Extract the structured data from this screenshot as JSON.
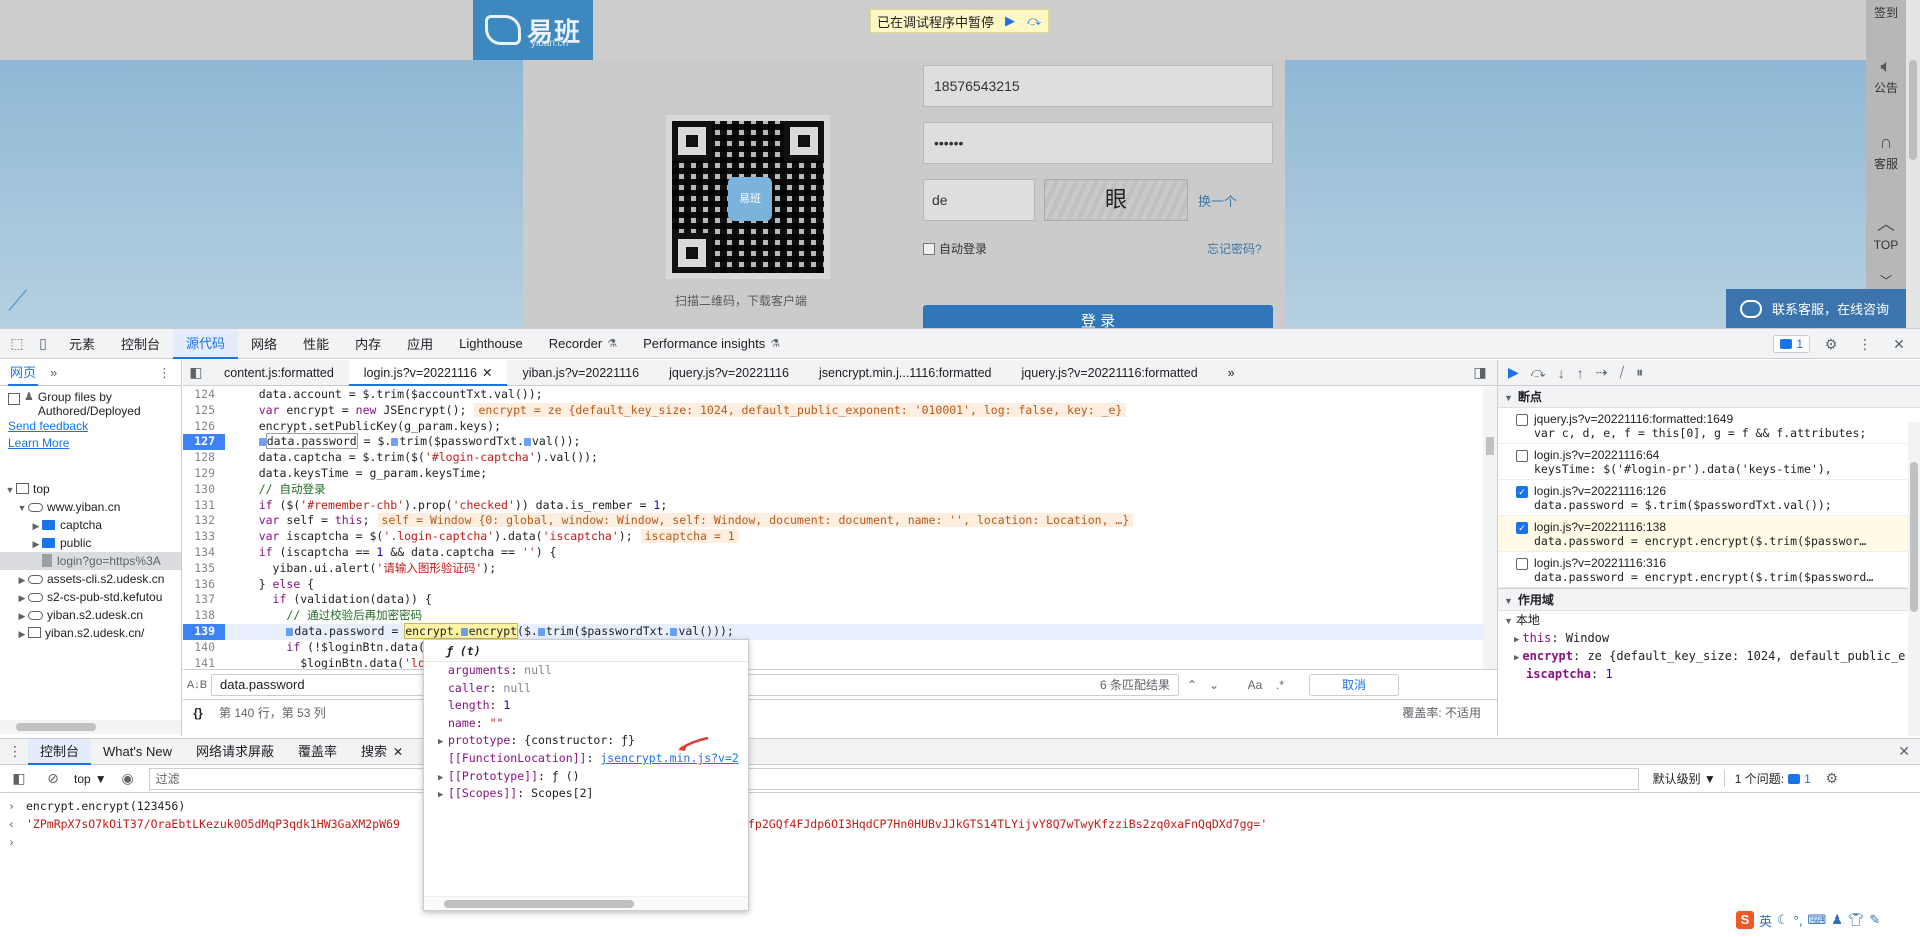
{
  "page": {
    "logo_text": "易班",
    "logo_sub": "yiban.cn",
    "paused_text": "已在调试程序中暂停",
    "qr_badge": "易班",
    "qr_caption": "扫描二维码，下载客户端",
    "phone_value": "18576543215",
    "password_value": "••••••",
    "captcha_value": "de",
    "captcha_image_text": "眼",
    "captcha_refresh": "换一个",
    "remember_label": "自动登录",
    "forgot_label": "忘记密码?",
    "login_label": "登 录",
    "rail": {
      "signin": "签到",
      "notice": "公告",
      "service": "客服",
      "top": "TOP"
    },
    "service_bar": "联系客服，在线咨询"
  },
  "devtools": {
    "main_tabs": [
      "元素",
      "控制台",
      "源代码",
      "网络",
      "性能",
      "内存",
      "应用",
      "Lighthouse",
      "Recorder",
      "Performance insights"
    ],
    "issue_count": "1",
    "navigator": {
      "tab_active": "网页",
      "group_files": "Group files by Authored/Deployed",
      "send_feedback": "Send feedback",
      "learn_more": "Learn More",
      "tree": [
        {
          "label": "top"
        },
        {
          "label": "www.yiban.cn"
        },
        {
          "label": "captcha"
        },
        {
          "label": "public"
        },
        {
          "label": "login?go=https%3A"
        },
        {
          "label": "assets-cli.s2.udesk.cn"
        },
        {
          "label": "s2-cs-pub-std.kefutou"
        },
        {
          "label": "yiban.s2.udesk.cn"
        },
        {
          "label": "yiban.s2.udesk.cn/"
        }
      ]
    },
    "file_tabs": [
      "content.js:formatted",
      "login.js?v=20221116",
      "yiban.js?v=20221116",
      "jquery.js?v=20221116",
      "jsencrypt.min.j...1116:formatted",
      "jquery.js?v=20221116:formatted"
    ],
    "code_lines": [
      {
        "n": "124"
      },
      {
        "n": "125"
      },
      {
        "n": "126"
      },
      {
        "n": "127"
      },
      {
        "n": "128"
      },
      {
        "n": "129"
      },
      {
        "n": "130"
      },
      {
        "n": "131"
      },
      {
        "n": "132"
      },
      {
        "n": "133"
      },
      {
        "n": "134"
      },
      {
        "n": "135"
      },
      {
        "n": "136"
      },
      {
        "n": "137"
      },
      {
        "n": "138"
      },
      {
        "n": "139"
      },
      {
        "n": "140"
      },
      {
        "n": "141"
      }
    ],
    "inline_values": {
      "encrypt": "encrypt = ze {default_key_size: 1024, default_public_exponent: '010001', log: false, key: _e}",
      "self": "self = Window {0: global, window: Window, self: Window, document: document, name: '', location: Location, …}",
      "iscaptcha": "iscaptcha = 1"
    },
    "search": {
      "value": "data.password",
      "match_count": "6 条匹配结果",
      "aa": "Aa",
      "regex": ".*",
      "cancel": "取消"
    },
    "status": {
      "position": "第 140 行，第 53 列",
      "coverage": "覆盖率: 不适用"
    },
    "debugger": {
      "breakpoints_title": "断点",
      "breakpoints": [
        {
          "file": "jquery.js?v=20221116:formatted:1649",
          "code": "var c, d, e, f = this[0], g = f && f.attributes;",
          "checked": false
        },
        {
          "file": "login.js?v=20221116:64",
          "code": "keysTime: $('#login-pr').data('keys-time'),",
          "checked": false
        },
        {
          "file": "login.js?v=20221116:126",
          "code": "data.password = $.trim($passwordTxt.val());",
          "checked": true
        },
        {
          "file": "login.js?v=20221116:138",
          "code": "data.password = encrypt.encrypt($.trim($passwor…",
          "checked": true
        },
        {
          "file": "login.js?v=20221116:316",
          "code": "data.password = encrypt.encrypt($.trim($password…",
          "checked": false
        }
      ],
      "scope_title": "作用域",
      "local_title": "本地",
      "scope": {
        "this": "Window",
        "encrypt": "ze {default_key_size: 1024, default_public_e",
        "iscaptcha": "1"
      }
    },
    "popover": {
      "head": "ƒ (t)",
      "rows": [
        {
          "k": "arguments",
          "v": "null"
        },
        {
          "k": "caller",
          "v": "null"
        },
        {
          "k": "length",
          "v": "1"
        },
        {
          "k": "name",
          "v": "\"\""
        },
        {
          "k": "prototype",
          "v": "{constructor: ƒ}"
        },
        {
          "k": "[[FunctionLocation]]",
          "v": "jsencrypt.min.js?v=2"
        },
        {
          "k": "[[Prototype]]",
          "v": "ƒ ()"
        },
        {
          "k": "[[Scopes]]",
          "v": "Scopes[2]"
        }
      ]
    },
    "drawer": {
      "tabs": [
        "控制台",
        "What's New",
        "网络请求屏蔽",
        "覆盖率",
        "搜索"
      ],
      "context": "top",
      "filter_placeholder": "过滤",
      "levels": "默认级别 ▼",
      "issues": "1 个问题:",
      "issues_count": "1",
      "input_line": "encrypt.encrypt(123456)",
      "output_left": "'ZPmRpX7sO7kOiT37/OraEbtLKezuk0O5dMqP3qdk1HW3GaXM2pW69",
      "output_right": "fp2GQf4FJdp6OI3HqdCP7Hn0HUBvJJkGTS14TLYijvY8Q7wTwyKfzziBs2zq0xaFnQqDXd7gg='"
    },
    "ime": {
      "mode": "英"
    }
  }
}
